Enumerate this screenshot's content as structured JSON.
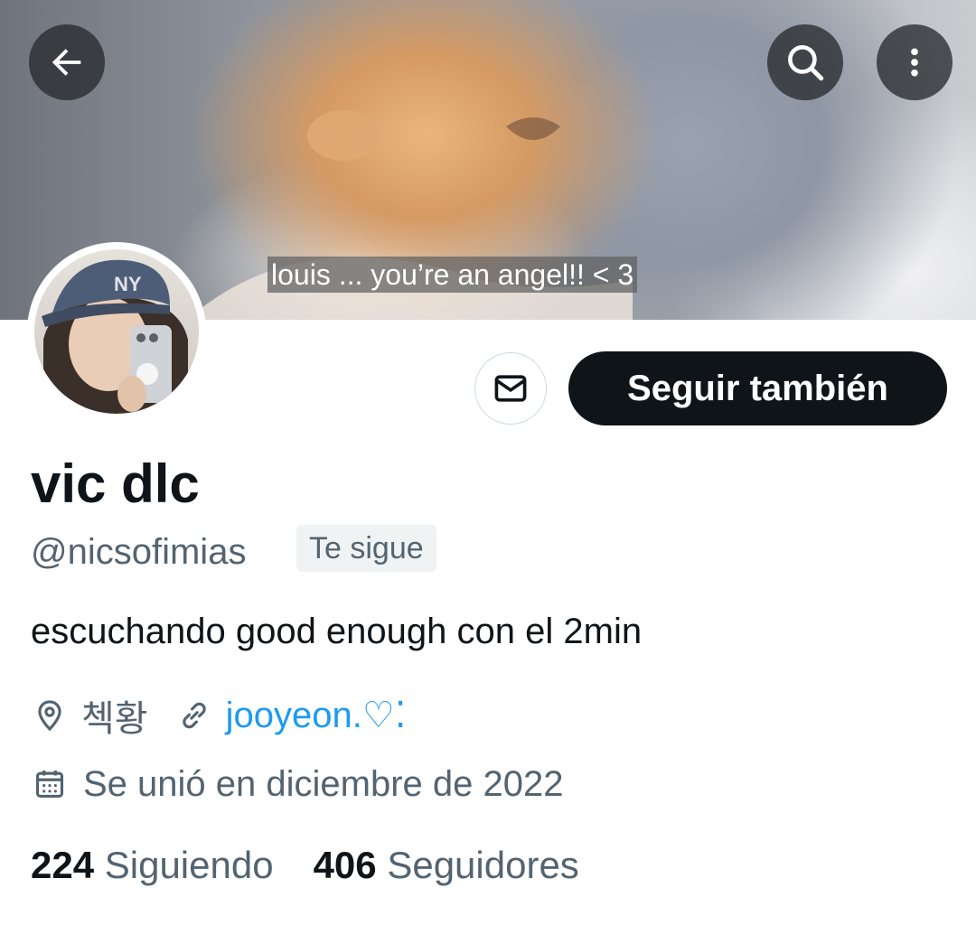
{
  "banner": {
    "caption": "louis ... you’re an angel!! < 3"
  },
  "header": {
    "back_icon": "arrow-left-icon",
    "search_icon": "search-icon",
    "more_icon": "more-vertical-icon"
  },
  "profile": {
    "display_name": "vic dlc",
    "handle": "@nicsofimias",
    "follows_you": "Te sigue",
    "bio": "escuchando good enough con el 2min",
    "location": "첵황",
    "website": "jooyeon.♡⁚",
    "joined": "Se unió en diciembre de 2022"
  },
  "actions": {
    "message_icon": "envelope-icon",
    "follow_label": "Seguir también"
  },
  "stats": {
    "following_count": "224",
    "following_label": "Siguiendo",
    "followers_count": "406",
    "followers_label": "Seguidores"
  },
  "colors": {
    "accent_link": "#1d9bf0",
    "primary_button": "#0f1419",
    "secondary_text": "#536471"
  }
}
